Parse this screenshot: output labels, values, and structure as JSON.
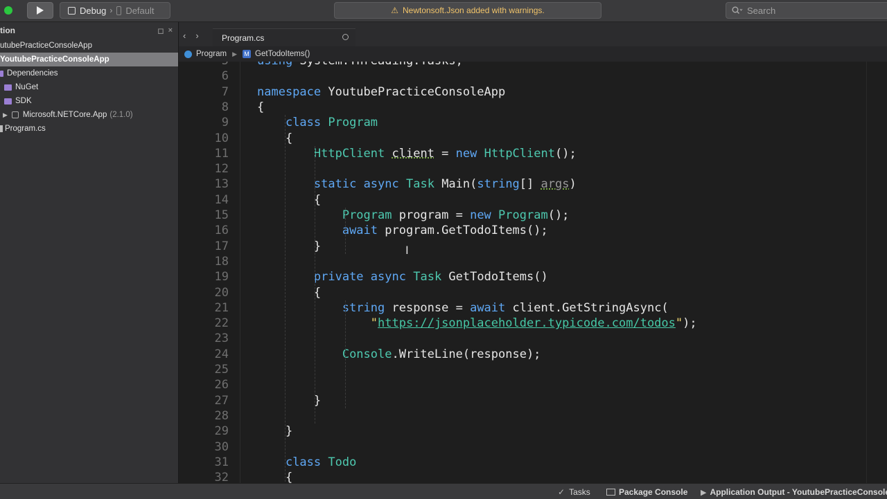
{
  "toolbar": {
    "config": "Debug",
    "device": "Default",
    "status": "Newtonsoft.Json added with warnings.",
    "search_placeholder": "Search",
    "status_color": "#f0c36a"
  },
  "sidebar": {
    "title": "tion",
    "items": [
      {
        "label": "utubePracticeConsoleApp"
      },
      {
        "label": "YoutubePracticeConsoleApp"
      },
      {
        "label": "Dependencies"
      },
      {
        "label": "NuGet"
      },
      {
        "label": "SDK"
      },
      {
        "label": "Microsoft.NETCore.App",
        "version": "(2.1.0)"
      },
      {
        "label": "Program.cs"
      }
    ]
  },
  "editor": {
    "tab": "Program.cs",
    "breadcrumb_class": "Program",
    "breadcrumb_method": "GetTodoItems()",
    "lines": [
      {
        "n": "5",
        "html": "<span class=\"k\">using</span> System.Threading.Tasks;"
      },
      {
        "n": "6",
        "html": ""
      },
      {
        "n": "7",
        "html": "<span class=\"k\">namespace</span> YoutubePracticeConsoleApp"
      },
      {
        "n": "8",
        "html": "{"
      },
      {
        "n": "9",
        "html": "    <span class=\"k\">class</span> <span class=\"t\">Program</span>"
      },
      {
        "n": "10",
        "html": "    {"
      },
      {
        "n": "11",
        "html": "        <span class=\"t\">HttpClient</span> <span class=\"squig\">client</span> = <span class=\"k\">new</span> <span class=\"t\">HttpClient</span>();"
      },
      {
        "n": "12",
        "html": ""
      },
      {
        "n": "13",
        "html": "        <span class=\"k\">static</span> <span class=\"k\">async</span> <span class=\"t\">Task</span> Main(<span class=\"k\">string</span>[] <span class=\"p squig\">args</span>)"
      },
      {
        "n": "14",
        "html": "        {"
      },
      {
        "n": "15",
        "html": "            <span class=\"t\">Program</span> program = <span class=\"k\">new</span> <span class=\"t\">Program</span>();"
      },
      {
        "n": "16",
        "html": "            <span class=\"k\">await</span> program.GetTodoItems();"
      },
      {
        "n": "17",
        "html": "        }"
      },
      {
        "n": "18",
        "html": ""
      },
      {
        "n": "19",
        "html": "        <span class=\"k\">private</span> <span class=\"k\">async</span> <span class=\"t\">Task</span> GetTodoItems()"
      },
      {
        "n": "20",
        "html": "        {"
      },
      {
        "n": "21",
        "html": "            <span class=\"k\">string</span> response = <span class=\"k\">await</span> client.GetStringAsync("
      },
      {
        "n": "22",
        "html": "                <span class=\"s\">\"</span><span class=\"u\">https://jsonplaceholder.typicode.com/todos</span><span class=\"s\">\"</span>);"
      },
      {
        "n": "23",
        "html": ""
      },
      {
        "n": "24",
        "html": "            <span class=\"t\">Console</span>.WriteLine(response);"
      },
      {
        "n": "25",
        "html": ""
      },
      {
        "n": "26",
        "html": ""
      },
      {
        "n": "27",
        "html": "        }"
      },
      {
        "n": "28",
        "html": ""
      },
      {
        "n": "29",
        "html": "    }"
      },
      {
        "n": "30",
        "html": ""
      },
      {
        "n": "31",
        "html": "    <span class=\"k\">class</span> <span class=\"t\">Todo</span>"
      },
      {
        "n": "32",
        "html": "    {"
      }
    ]
  },
  "bottombar": {
    "tasks": "Tasks",
    "package_console": "Package Console",
    "app_output": "Application Output - YoutubePracticeConsoleApp"
  }
}
